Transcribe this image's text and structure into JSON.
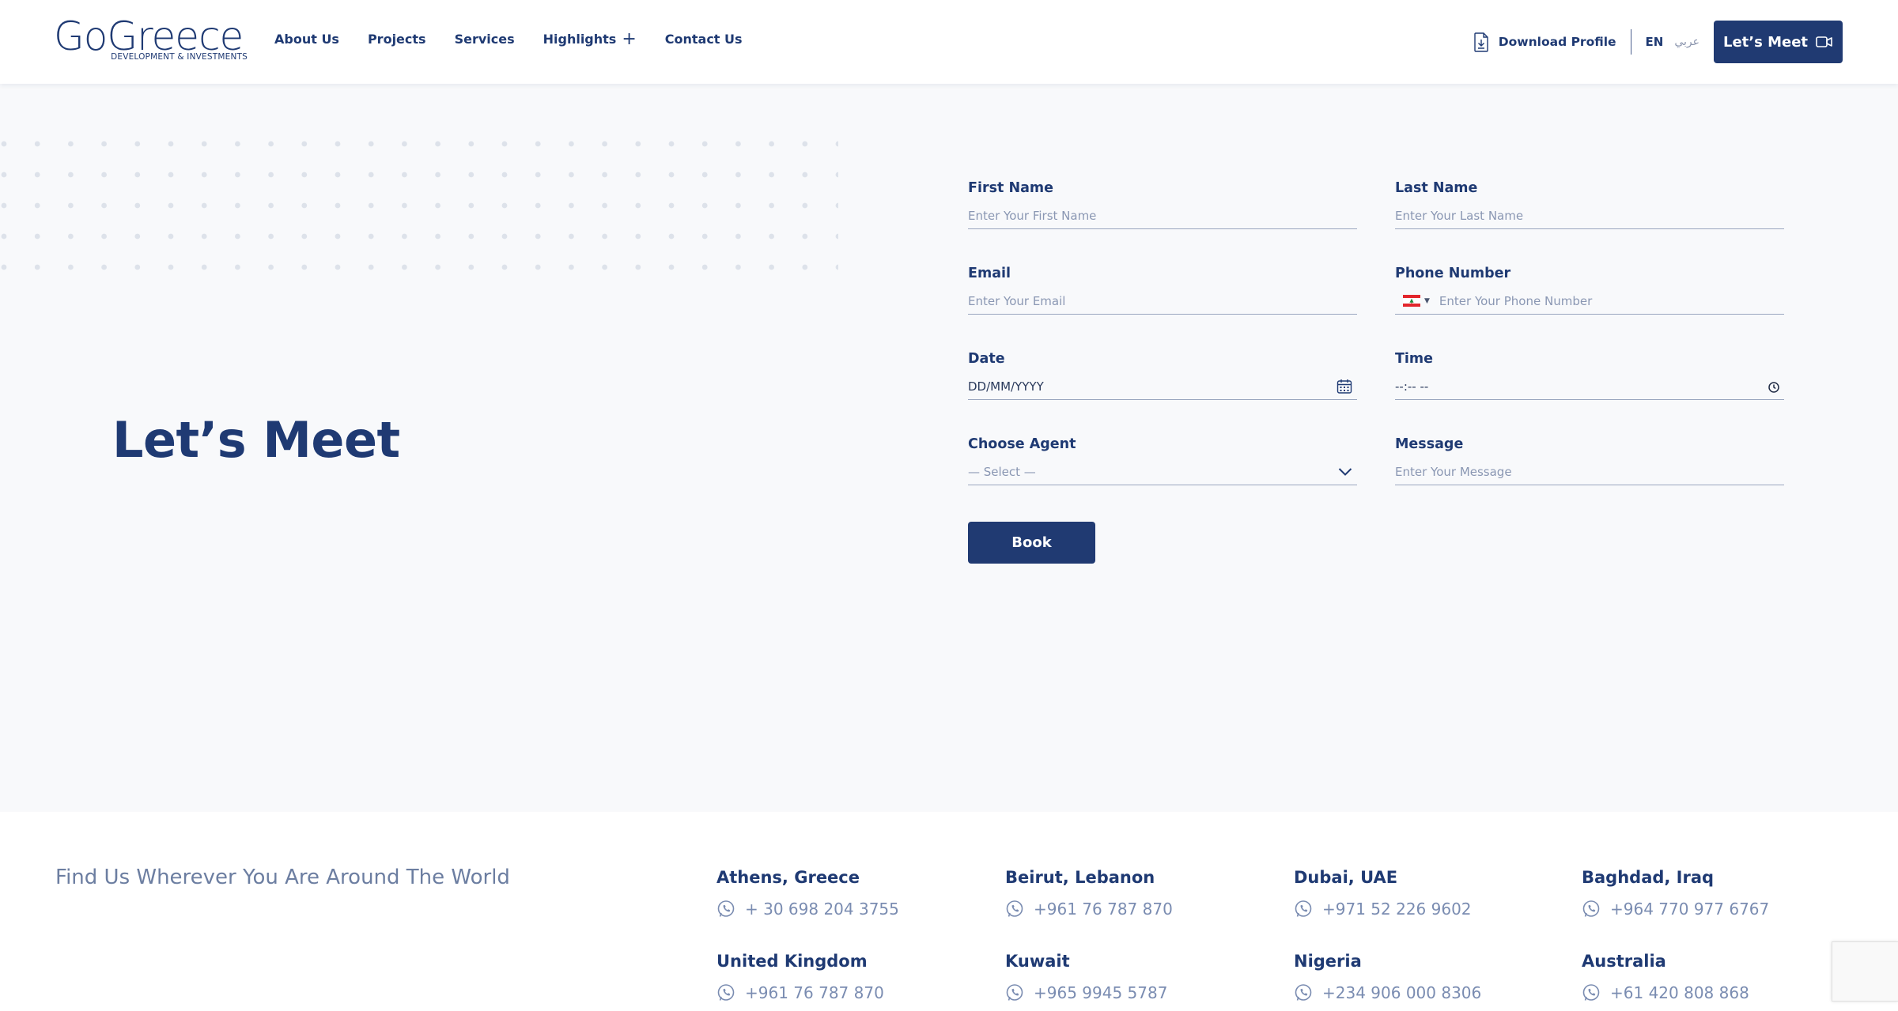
{
  "header": {
    "logo_main": "GoGreece",
    "logo_sub": "DEVELOPMENT & INVESTMENTS",
    "nav": [
      {
        "label": "About Us"
      },
      {
        "label": "Projects"
      },
      {
        "label": "Services"
      },
      {
        "label": "Highlights"
      },
      {
        "label": "Contact Us"
      }
    ],
    "download_label": "Download Profile",
    "lang_en": "EN",
    "lang_ar": "عربي",
    "cta_label": "Let’s Meet"
  },
  "hero": {
    "title": "Let’s Meet"
  },
  "form": {
    "first_name": {
      "label": "First Name",
      "placeholder": "Enter Your First Name"
    },
    "last_name": {
      "label": "Last Name",
      "placeholder": "Enter Your Last Name"
    },
    "email": {
      "label": "Email",
      "placeholder": "Enter Your Email"
    },
    "phone": {
      "label": "Phone Number",
      "placeholder": "Enter Your Phone Number",
      "country": "Lebanon"
    },
    "date": {
      "label": "Date",
      "value": "DD/MM/YYYY"
    },
    "time": {
      "label": "Time",
      "value": "--:-- --"
    },
    "agent": {
      "label": "Choose Agent",
      "selected": "— Select —"
    },
    "message": {
      "label": "Message",
      "placeholder": "Enter Your Message"
    },
    "submit_label": "Book"
  },
  "footer": {
    "heading": "Find Us Wherever You Are Around The World",
    "offices": [
      {
        "city": "Athens, Greece",
        "phone": "+ 30 698 204 3755"
      },
      {
        "city": "Beirut, Lebanon",
        "phone": "+961 76 787 870"
      },
      {
        "city": "Dubai, UAE",
        "phone": "+971 52 226 9602"
      },
      {
        "city": "Baghdad, Iraq",
        "phone": "+964 770 977 6767"
      },
      {
        "city": "United Kingdom",
        "phone": "+961 76 787 870"
      },
      {
        "city": "Kuwait",
        "phone": "+965 9945 5787"
      },
      {
        "city": "Nigeria",
        "phone": "+234 906 000 8306"
      },
      {
        "city": "Australia",
        "phone": "+61 420 808 868"
      }
    ]
  },
  "colors": {
    "brand_navy": "#203a72",
    "background": "#f8f9fb",
    "muted_text": "#8a97b3"
  }
}
